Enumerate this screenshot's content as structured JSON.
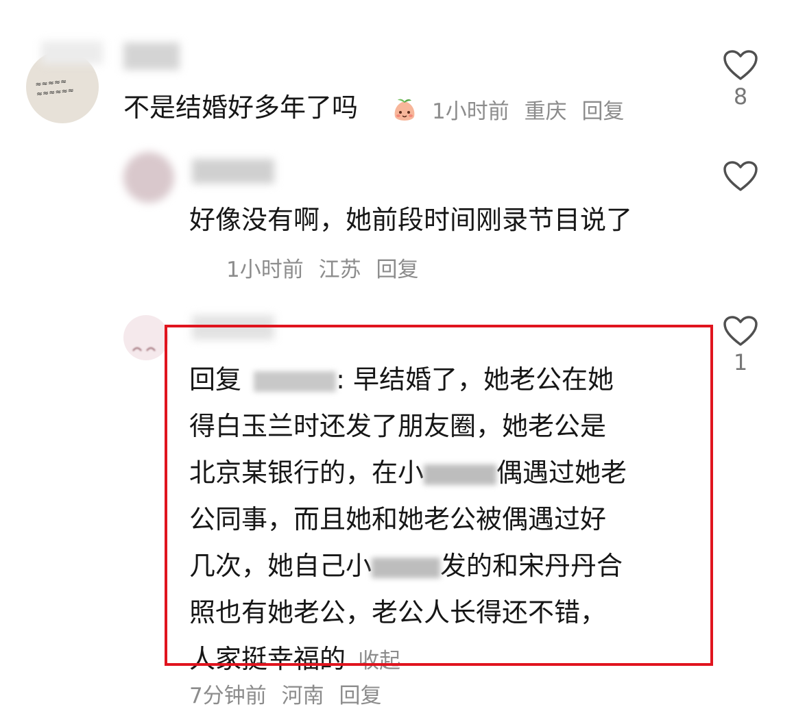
{
  "comments": [
    {
      "text": "不是结婚好多年了吗",
      "emoji": "peach-face-emoji",
      "time": "1小时前",
      "location": "重庆",
      "reply_label": "回复",
      "likes": "8"
    },
    {
      "text": "好像没有啊，她前段时间刚录节目说了",
      "time": "1小时前",
      "location": "江苏",
      "reply_label": "回复"
    },
    {
      "reply_prefix": "回复",
      "text_line1": "早结婚了，她老公在她",
      "text_line2": "得白玉兰时还发了朋友圈，她老公是",
      "text_line3a": "北京某银行的，在小",
      "text_line3b": "偶遇过她老",
      "text_line4": "公同事，而且她和她老公被偶遇过好",
      "text_line5a": "几次，她自己小",
      "text_line5b": "发的和宋丹丹合",
      "text_line6": "照也有她老公，老公人长得还不错，",
      "text_line7": "人家挺幸福的",
      "collapse_label": "收起",
      "time": "7分钟前",
      "location": "河南",
      "reply_label": "回复",
      "likes": "1"
    }
  ],
  "highlight_color": "#e0141e"
}
